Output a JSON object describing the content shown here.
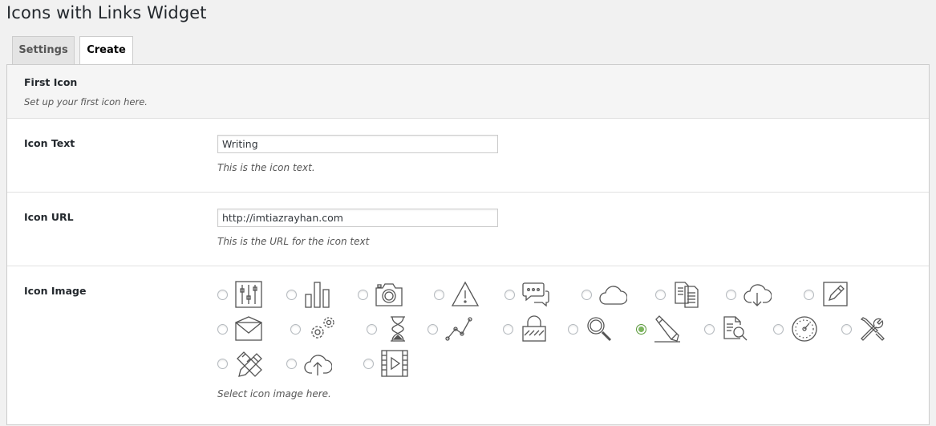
{
  "page": {
    "title": "Icons with Links Widget"
  },
  "tabs": [
    {
      "label": "Settings",
      "active": false
    },
    {
      "label": "Create",
      "active": true
    }
  ],
  "section": {
    "title": "First Icon",
    "description": "Set up your first icon here."
  },
  "fields": {
    "icon_text": {
      "label": "Icon Text",
      "value": "Writing",
      "description": "This is the icon text."
    },
    "icon_url": {
      "label": "Icon URL",
      "value": "http://imtiazrayhan.com",
      "description": "This is the URL for the icon text"
    },
    "icon_image": {
      "label": "Icon Image",
      "description": "Select icon image here.",
      "selected": "pencil-ruler-icon",
      "options": [
        "sliders-icon",
        "bar-chart-icon",
        "camera-icon",
        "warning-icon",
        "chat-icon",
        "cloud-icon",
        "documents-icon",
        "cloud-download-icon",
        "edit-icon",
        "envelope-icon",
        "gears-icon",
        "hourglass-icon",
        "line-graph-icon",
        "lock-icon",
        "magnifier-icon",
        "pencil-ruler-icon",
        "document-search-icon",
        "speedometer-icon",
        "tools-icon",
        "design-icon",
        "cloud-upload-icon",
        "video-icon"
      ]
    }
  },
  "colors": {
    "accent_selected": "#7ab55c",
    "icon_stroke": "#555555"
  }
}
